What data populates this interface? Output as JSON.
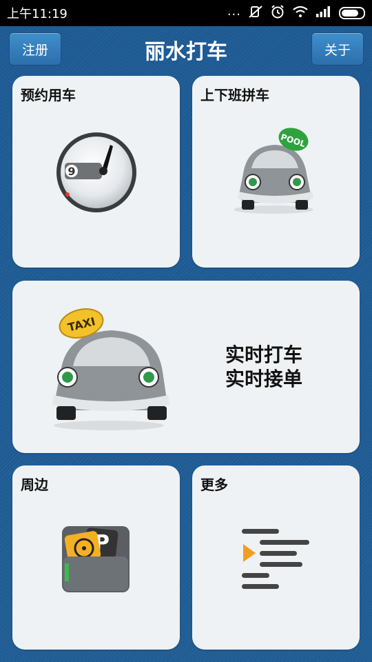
{
  "status_bar": {
    "time": "上午11:19",
    "dots": "...",
    "icons": [
      "mute-icon",
      "alarm-icon",
      "wifi-icon",
      "signal-icon",
      "battery-icon"
    ]
  },
  "header": {
    "title": "丽水打车",
    "left_button": "注册",
    "right_button": "关于"
  },
  "tiles": {
    "reserve": {
      "label": "预约用车",
      "icon": "clock-icon"
    },
    "commute": {
      "label": "上下班拼车",
      "icon": "carpool-car-icon",
      "badge": "POOL"
    },
    "realtime": {
      "line1": "实时打车",
      "line2": "实时接单",
      "icon": "taxi-car-icon",
      "badge": "TAXI"
    },
    "nearby": {
      "label": "周边",
      "icon": "wallet-parking-icon",
      "badge": "P"
    },
    "more": {
      "label": "更多",
      "icon": "list-menu-icon"
    }
  },
  "colors": {
    "background": "#1f5a92",
    "button": "#3a86c3",
    "tile": "#eef2f4"
  }
}
